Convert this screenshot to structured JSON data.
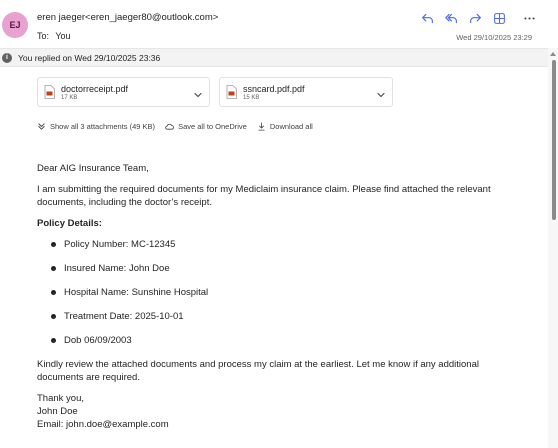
{
  "header": {
    "avatar_initials": "EJ",
    "from": "eren jaeger<eren_jaeger80@outlook.com>",
    "to_label": "To:",
    "to_value": "You",
    "date": "Wed 29/10/2025 23:29",
    "actions": [
      "reply-icon",
      "reply-all-icon",
      "forward-icon",
      "apps-icon",
      "more-icon"
    ]
  },
  "info_bar": {
    "text": "You replied on Wed 29/10/2025 23:36"
  },
  "attachments": [
    {
      "name": "doctorreceipt.pdf",
      "size": "17 KB"
    },
    {
      "name": "ssncard.pdf.pdf",
      "size": "15 KB"
    }
  ],
  "attachment_actions": {
    "show_all": "Show all 3 attachments (49 KB)",
    "save_onedrive": "Save all to OneDrive",
    "download_all": "Download all"
  },
  "body": {
    "greeting": "Dear AIG Insurance Team,",
    "intro": "I am submitting the required documents for my Mediclaim insurance claim. Please find attached the relevant documents, including the doctor’s receipt.",
    "policy_heading": "Policy Details:",
    "policy_items": [
      "Policy Number: MC-12345",
      "Insured Name: John Doe",
      "Hospital Name: Sunshine Hospital",
      "Treatment Date: 2025-10-01",
      "Dob 06/09/2003"
    ],
    "closing": "Kindly review the attached documents and process my claim at the earliest. Let me know if any additional documents are required.",
    "signoff": [
      "Thank you,",
      "John Doe",
      "Email: john.doe@example.com"
    ]
  },
  "colors": {
    "avatar_bg": "#e8a1d0",
    "action_icon": "#4f6bed",
    "pdf_red": "#c43e1c",
    "info_bar_bg": "#f3f3f3"
  }
}
